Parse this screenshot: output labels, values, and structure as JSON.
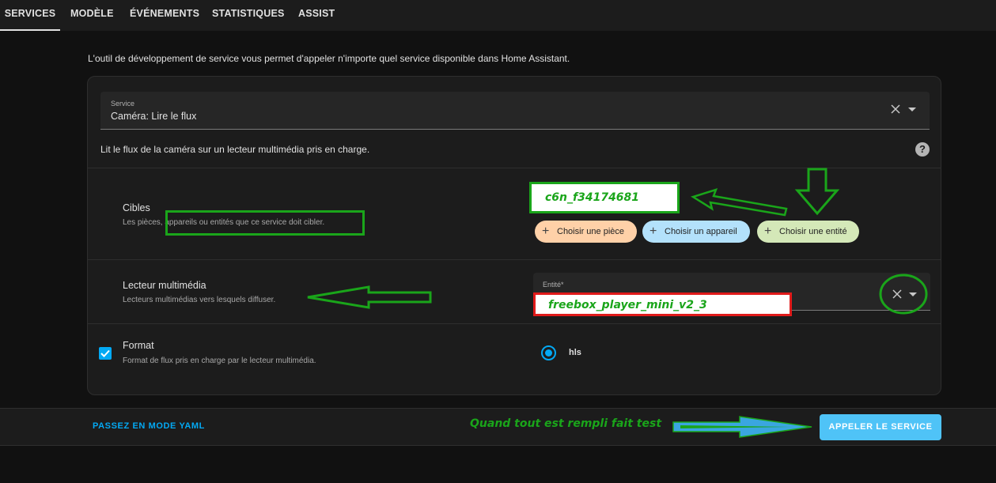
{
  "tabs": [
    "SERVICES",
    "MODÈLE",
    "ÉVÉNEMENTS",
    "STATISTIQUES",
    "ASSIST"
  ],
  "intro": "L'outil de développement de service vous permet d'appeler n'importe quel service disponible dans Home Assistant.",
  "service_field": {
    "label": "Service",
    "value": "Caméra: Lire le flux"
  },
  "service_description": "Lit le flux de la caméra sur un lecteur multimédia pris en charge.",
  "help_icon": "?",
  "targets": {
    "title": "Cibles",
    "description": "Les pièces, appareils ou entités que ce service doit cibler.",
    "chips": [
      "Choisir une pièce",
      "Choisir un appareil",
      "Choisir une entité"
    ],
    "chip_icon": "+"
  },
  "media_player": {
    "title": "Lecteur multimédia",
    "description": "Lecteurs multimédias vers lesquels diffuser.",
    "field_label": "Entité*"
  },
  "format": {
    "title": "Format",
    "description": "Format de flux pris en charge par le lecteur multimédia.",
    "option": "hls",
    "checked": true,
    "selected": true
  },
  "footer": {
    "yaml_button": "PASSEZ EN MODE YAML",
    "call_button": "APPELER LE SERVICE"
  },
  "annotations": {
    "target_value": "c6n_f34174681",
    "entity_value": "freebox_player_mini_v2_3",
    "test_note": "Quand tout est rempli fait test"
  },
  "colors": {
    "background": "#111111",
    "card": "#1c1c1c",
    "accent": "#03a9f4",
    "annotation_green": "#1aa51a",
    "annotation_red": "#e01a1a"
  }
}
